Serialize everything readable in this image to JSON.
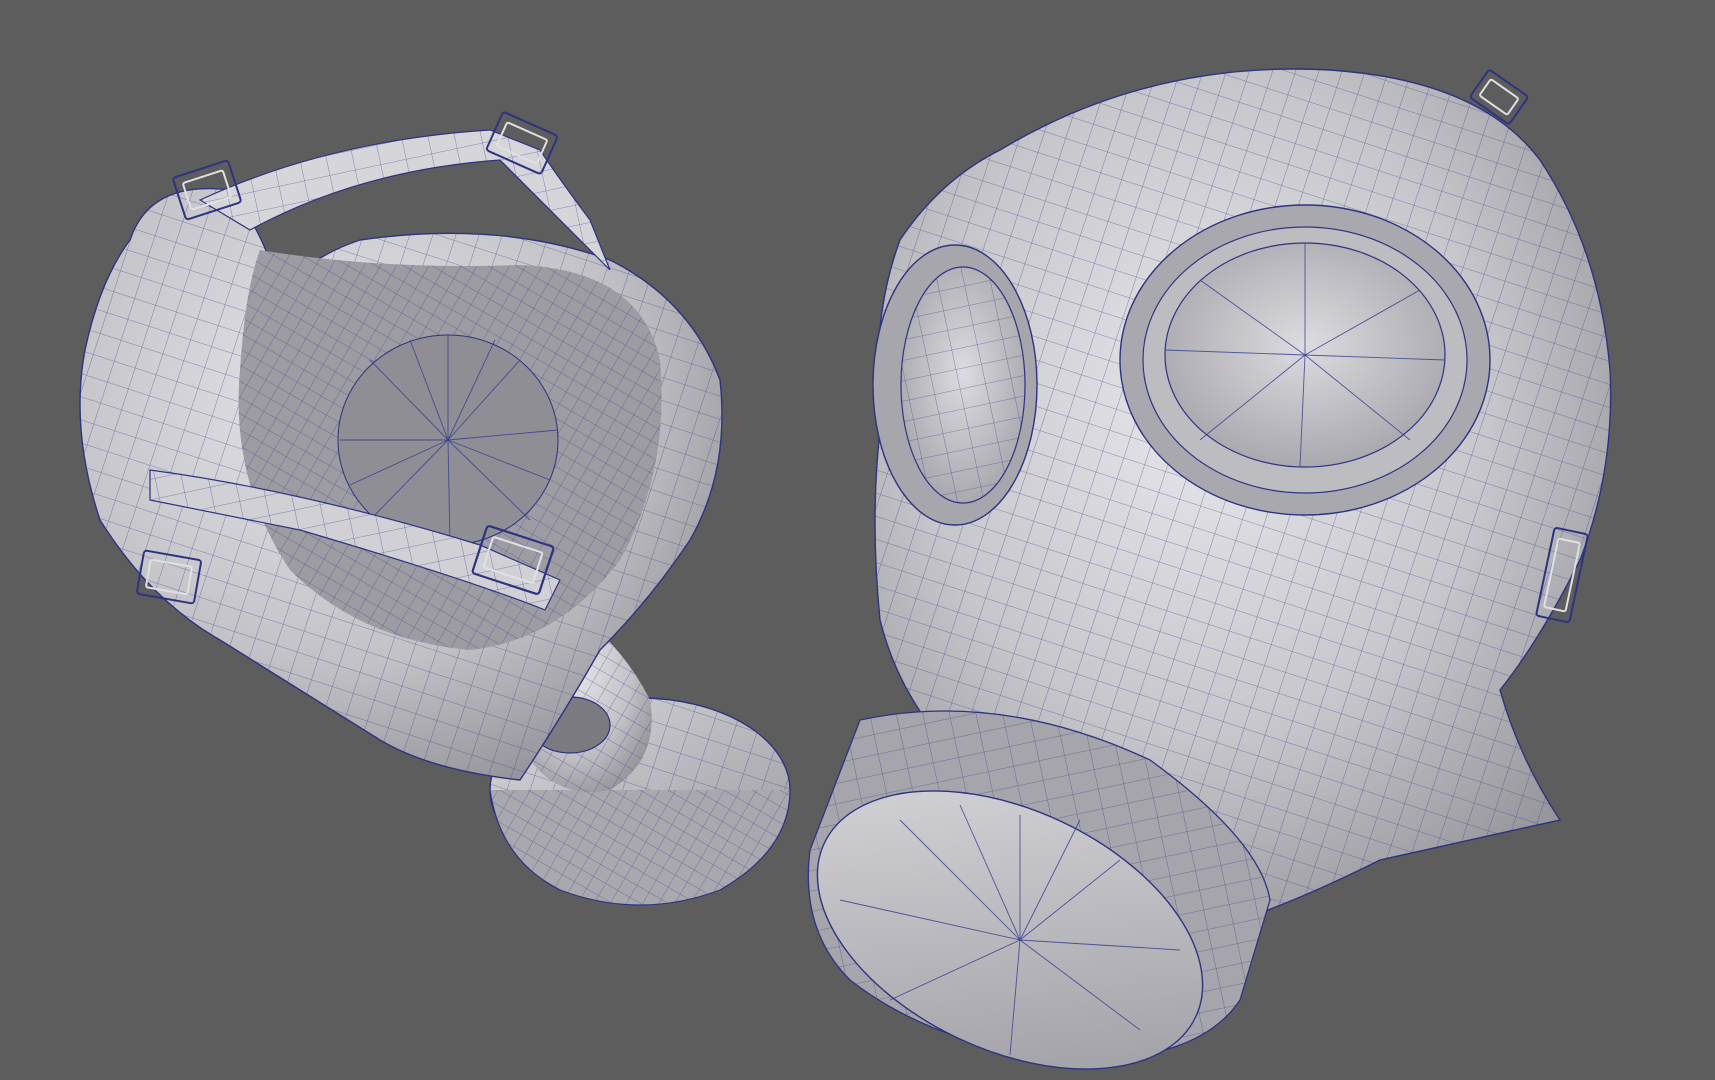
{
  "viewport": {
    "background_color": "#5d5d5d",
    "display_mode": "wireframe-on-shaded"
  },
  "scene": {
    "objects": [
      {
        "name": "gas-mask-back-view",
        "parts": [
          "strap-harness",
          "buckle",
          "buckle",
          "buckle",
          "buckle",
          "mask-interior",
          "hose-neck",
          "filter-canister"
        ]
      },
      {
        "name": "gas-mask-front-view",
        "parts": [
          "mask-face",
          "eye-lens",
          "eye-lens",
          "buckle",
          "buckle",
          "filter-canister"
        ]
      }
    ],
    "colors": {
      "mesh_shade": "#c4c4c8",
      "mesh_shadow": "#8d8d93",
      "mesh_highlight": "#e6e6ea",
      "wire": "#3a3f8f"
    }
  }
}
